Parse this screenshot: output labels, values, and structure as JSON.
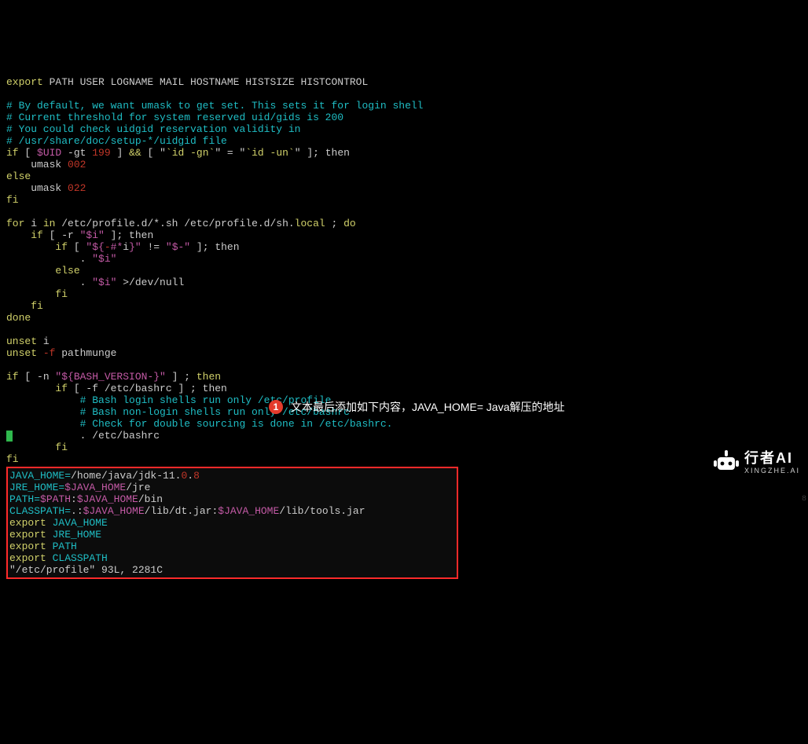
{
  "code": {
    "l1": "export",
    "l1b": " PATH USER LOGNAME MAIL HOSTNAME HISTSIZE HISTCONTROL",
    "c1": "# By default, we want umask to get set. This sets it for login shell",
    "c2": "# Current threshold for system reserved uid/gids is 200",
    "c3": "# You could check uidgid reservation validity in",
    "c4": "# /usr/share/doc/setup-*/uidgid file",
    "if1_a": "if",
    "if1_b": " [ ",
    "if1_uid": "$UID",
    "if1_c": " -gt ",
    "if1_num": "199",
    "if1_d": " ] ",
    "if1_amp": "&&",
    "if1_e": " [ \"",
    "if1_idgn": "`id -gn`",
    "if1_f": "\" = \"",
    "if1_idun": "`id -un`",
    "if1_g": "\" ]; then",
    "umask_a": "    umask ",
    "umask_002": "002",
    "else": "else",
    "umask_022": "022",
    "fi": "fi",
    "for_a": "for",
    "for_b": " i ",
    "for_in": "in",
    "for_c": " /etc/profile.d/*.sh /etc/profile.d/sh.",
    "for_local": "local",
    "for_d": " ; ",
    "for_do": "do",
    "ifr_a": "    if",
    "ifr_b": " [ -r ",
    "ifr_c": "\"$i\"",
    "ifr_d": " ]",
    "ifr_e": "; then",
    "ifh_a": "        if",
    "ifh_b": " [ ",
    "ifh_c": "\"${",
    "ifh_d": "-",
    "ifh_e": "#*",
    "ifh_e2": "i",
    "ifh_f": "}\"",
    "ifh_g": " != ",
    "ifh_h": "\"$-\"",
    "ifh_i": " ]",
    "ifh_j": "; then",
    "dot1": "            . ",
    "dot1_v": "\"$i\"",
    "else2": "        else",
    "dot2": "            . ",
    "dot2_v": "\"$i\"",
    "dot2_redir": " >/dev/null",
    "fi2": "        fi",
    "fi3": "    fi",
    "done": "done",
    "unset_i_a": "unset",
    "unset_i_b": " i",
    "unset_pm_a": "unset",
    "unset_pm_b": " -f",
    "unset_pm_c": " pathmunge",
    "ifbv_a": "if",
    "ifbv_b": " [ -n ",
    "ifbv_c": "\"${BASH_VERSION-}\"",
    "ifbv_d": " ] ; ",
    "ifbv_e": "then",
    "ifbr_a": "        if",
    "ifbr_b": " [ -f /etc/bashrc ] ; then",
    "bc1": "            # Bash login shells run only /etc/profile",
    "bc2": "            # Bash non-login shells run only /etc/bashrc",
    "bc3": "            # Check for double sourcing is done in /etc/bashrc.",
    "bdot": "            . /etc/bashrc",
    "bfi": "        fi"
  },
  "box": {
    "l1a": "JAVA_HOME=",
    "l1b": "/home/java/jdk-11.",
    "l1c": "0",
    "l1d": ".",
    "l1e": "8",
    "l2a": "JRE_HOME=",
    "l2b": "$JAVA_HOME",
    "l2c": "/jre",
    "l3a": "PATH=",
    "l3b": "$PATH",
    "l3c": ":",
    "l3d": "$JAVA_HOME",
    "l3e": "/bin",
    "l4a": "CLASSPATH=",
    "l4b": ".:",
    "l4c": "$JAVA_HOME",
    "l4d": "/lib/dt.jar:",
    "l4e": "$JAVA_HOME",
    "l4f": "/lib/tools.jar",
    "ex": "export",
    "e1": " JAVA_HOME",
    "e2": " JRE_HOME",
    "e3": " PATH",
    "e4": " CLASSPATH",
    "status": "\"/etc/profile\" 93L, 2281C"
  },
  "annotation": {
    "badge": "1",
    "text": "文本最后添加如下内容，JAVA_HOME= Java解压的地址"
  },
  "watermark": {
    "name": "行者AI",
    "sub": "XINGZHE.AI"
  },
  "misc": {
    "bottom_right_num": "8"
  }
}
